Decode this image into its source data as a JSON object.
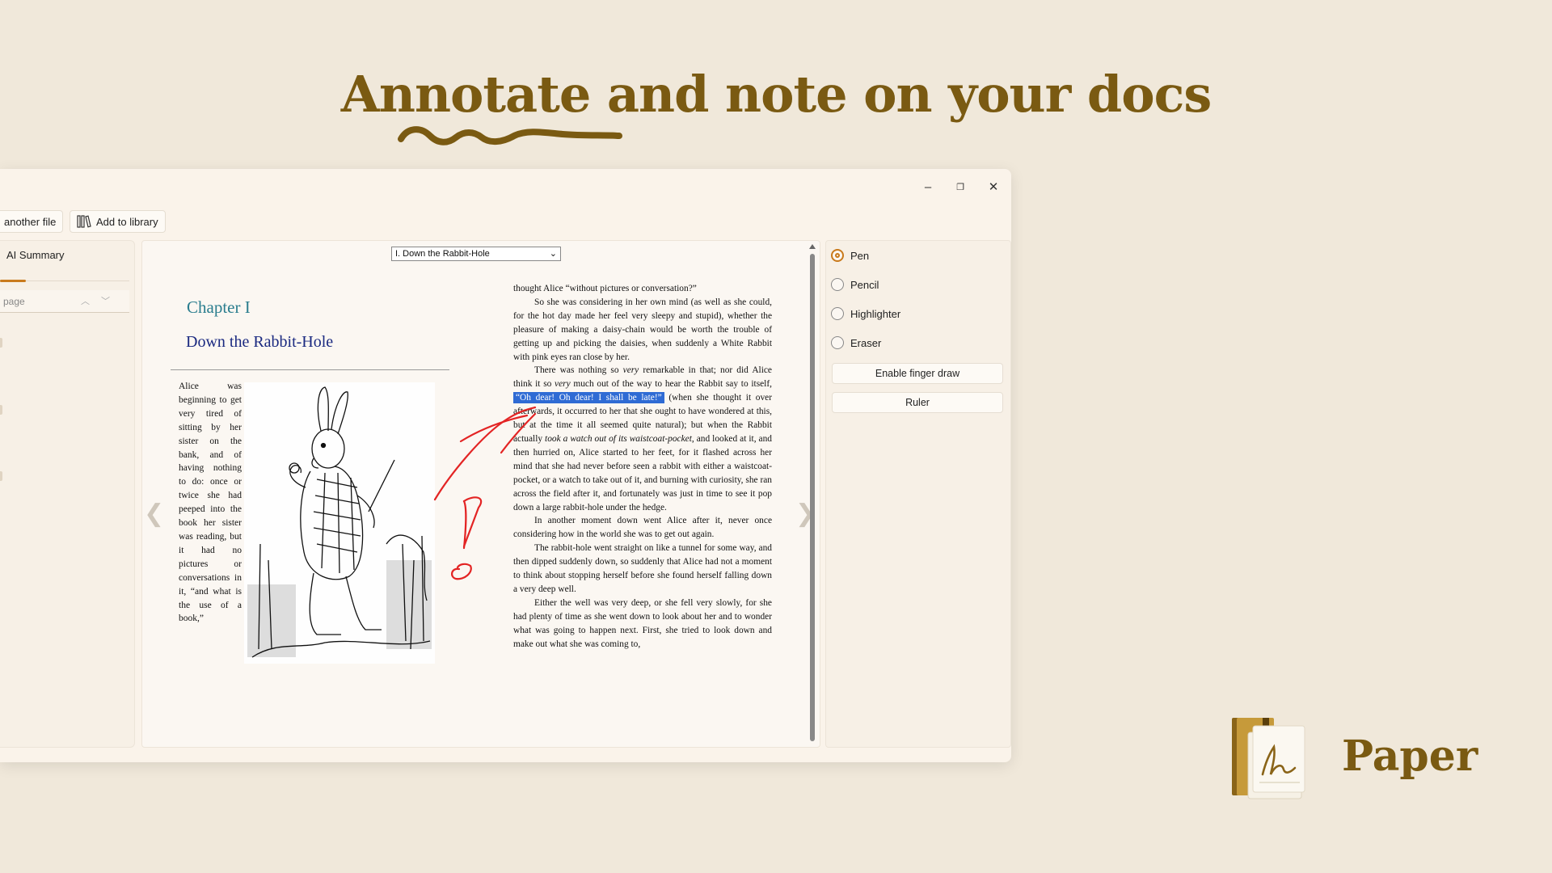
{
  "headline": "Annotate and note on your docs",
  "brand": {
    "name": "Paper"
  },
  "window": {
    "controls": {
      "minimize": "–",
      "restore": "❐",
      "close": "✕"
    },
    "toolbar": {
      "open_another_file": "another file",
      "add_to_library": "Add to library"
    }
  },
  "left_panel": {
    "tab": "AI Summary",
    "page_placeholder": "page"
  },
  "document": {
    "chapter_select": "I. Down the Rabbit-Hole",
    "chapter_heading": "Chapter I",
    "chapter_title": "Down the Rabbit-Hole",
    "narrow_text": "Alice was beginning to get very tired of sitting by her sister on the bank, and of having nothing to do: once or twice she had peeped into the book her sister was reading, but it had no pictures or conversations in it, “and what is the use of a book,”",
    "p1": "thought Alice “without pictures or conversation?”",
    "p2": "So she was considering in her own mind (as well as she could, for the hot day made her feel very sleepy and stupid), whether the pleasure of making a daisy-chain would be worth the trouble of getting up and picking the daisies, when suddenly a White Rabbit with pink eyes ran close by her.",
    "p3_a": "There was nothing so ",
    "p3_em1": "very",
    "p3_b": " remarkable in that; nor did Alice think it so ",
    "p3_em2": "very",
    "p3_c": " much out of the way to hear the Rabbit say to itself, ",
    "p3_highlight": "“Oh dear! Oh dear! I shall be late!”",
    "p3_d": " (when she thought it over afterwards, it occurred to her that she ought to have wondered at this, but at the time it all seemed quite natural); but when the Rabbit actually ",
    "p3_em3": "took a watch out of its waistcoat-pocket",
    "p3_e": ", and looked at it, and then hurried on, Alice started to her feet, for it flashed across her mind that she had never before seen a rabbit with either a waistcoat-pocket, or a watch to take out of it, and burning with curiosity, she ran across the field after it, and fortunately was just in time to see it pop down a large rabbit-hole under the hedge.",
    "p4": "In another moment down went Alice after it, never once considering how in the world she was to get out again.",
    "p5": "The rabbit-hole went straight on like a tunnel for some way, and then dipped suddenly down, so suddenly that Alice had not a moment to think about stopping herself before she found herself falling down a very deep well.",
    "p6": "Either the well was very deep, or she fell very slowly, for she had plenty of time as she went down to look about her and to wonder what was going to happen next. First, she tried to look down and make out what she was coming to,",
    "prev_arrow": "❮",
    "next_arrow": "❯"
  },
  "tools": {
    "options": [
      "Pen",
      "Pencil",
      "Highlighter",
      "Eraser"
    ],
    "selected": "Pen",
    "enable_finger_draw": "Enable finger draw",
    "ruler": "Ruler"
  },
  "colors": {
    "background": "#f0e8da",
    "brand": "#7a5a12",
    "accent": "#c97a1c",
    "highlight": "#2f6bd4",
    "ink": "#e32424"
  }
}
